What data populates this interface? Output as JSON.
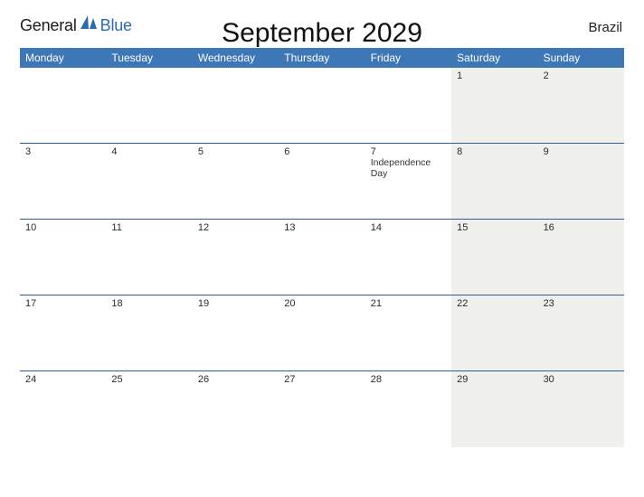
{
  "logo": {
    "text1": "General",
    "text2": "Blue"
  },
  "title": "September 2029",
  "country": "Brazil",
  "day_headers": [
    "Monday",
    "Tuesday",
    "Wednesday",
    "Thursday",
    "Friday",
    "Saturday",
    "Sunday"
  ],
  "weeks": [
    [
      {
        "num": "",
        "event": ""
      },
      {
        "num": "",
        "event": ""
      },
      {
        "num": "",
        "event": ""
      },
      {
        "num": "",
        "event": ""
      },
      {
        "num": "",
        "event": ""
      },
      {
        "num": "1",
        "event": ""
      },
      {
        "num": "2",
        "event": ""
      }
    ],
    [
      {
        "num": "3",
        "event": ""
      },
      {
        "num": "4",
        "event": ""
      },
      {
        "num": "5",
        "event": ""
      },
      {
        "num": "6",
        "event": ""
      },
      {
        "num": "7",
        "event": "Independence Day"
      },
      {
        "num": "8",
        "event": ""
      },
      {
        "num": "9",
        "event": ""
      }
    ],
    [
      {
        "num": "10",
        "event": ""
      },
      {
        "num": "11",
        "event": ""
      },
      {
        "num": "12",
        "event": ""
      },
      {
        "num": "13",
        "event": ""
      },
      {
        "num": "14",
        "event": ""
      },
      {
        "num": "15",
        "event": ""
      },
      {
        "num": "16",
        "event": ""
      }
    ],
    [
      {
        "num": "17",
        "event": ""
      },
      {
        "num": "18",
        "event": ""
      },
      {
        "num": "19",
        "event": ""
      },
      {
        "num": "20",
        "event": ""
      },
      {
        "num": "21",
        "event": ""
      },
      {
        "num": "22",
        "event": ""
      },
      {
        "num": "23",
        "event": ""
      }
    ],
    [
      {
        "num": "24",
        "event": ""
      },
      {
        "num": "25",
        "event": ""
      },
      {
        "num": "26",
        "event": ""
      },
      {
        "num": "27",
        "event": ""
      },
      {
        "num": "28",
        "event": ""
      },
      {
        "num": "29",
        "event": ""
      },
      {
        "num": "30",
        "event": ""
      }
    ]
  ]
}
